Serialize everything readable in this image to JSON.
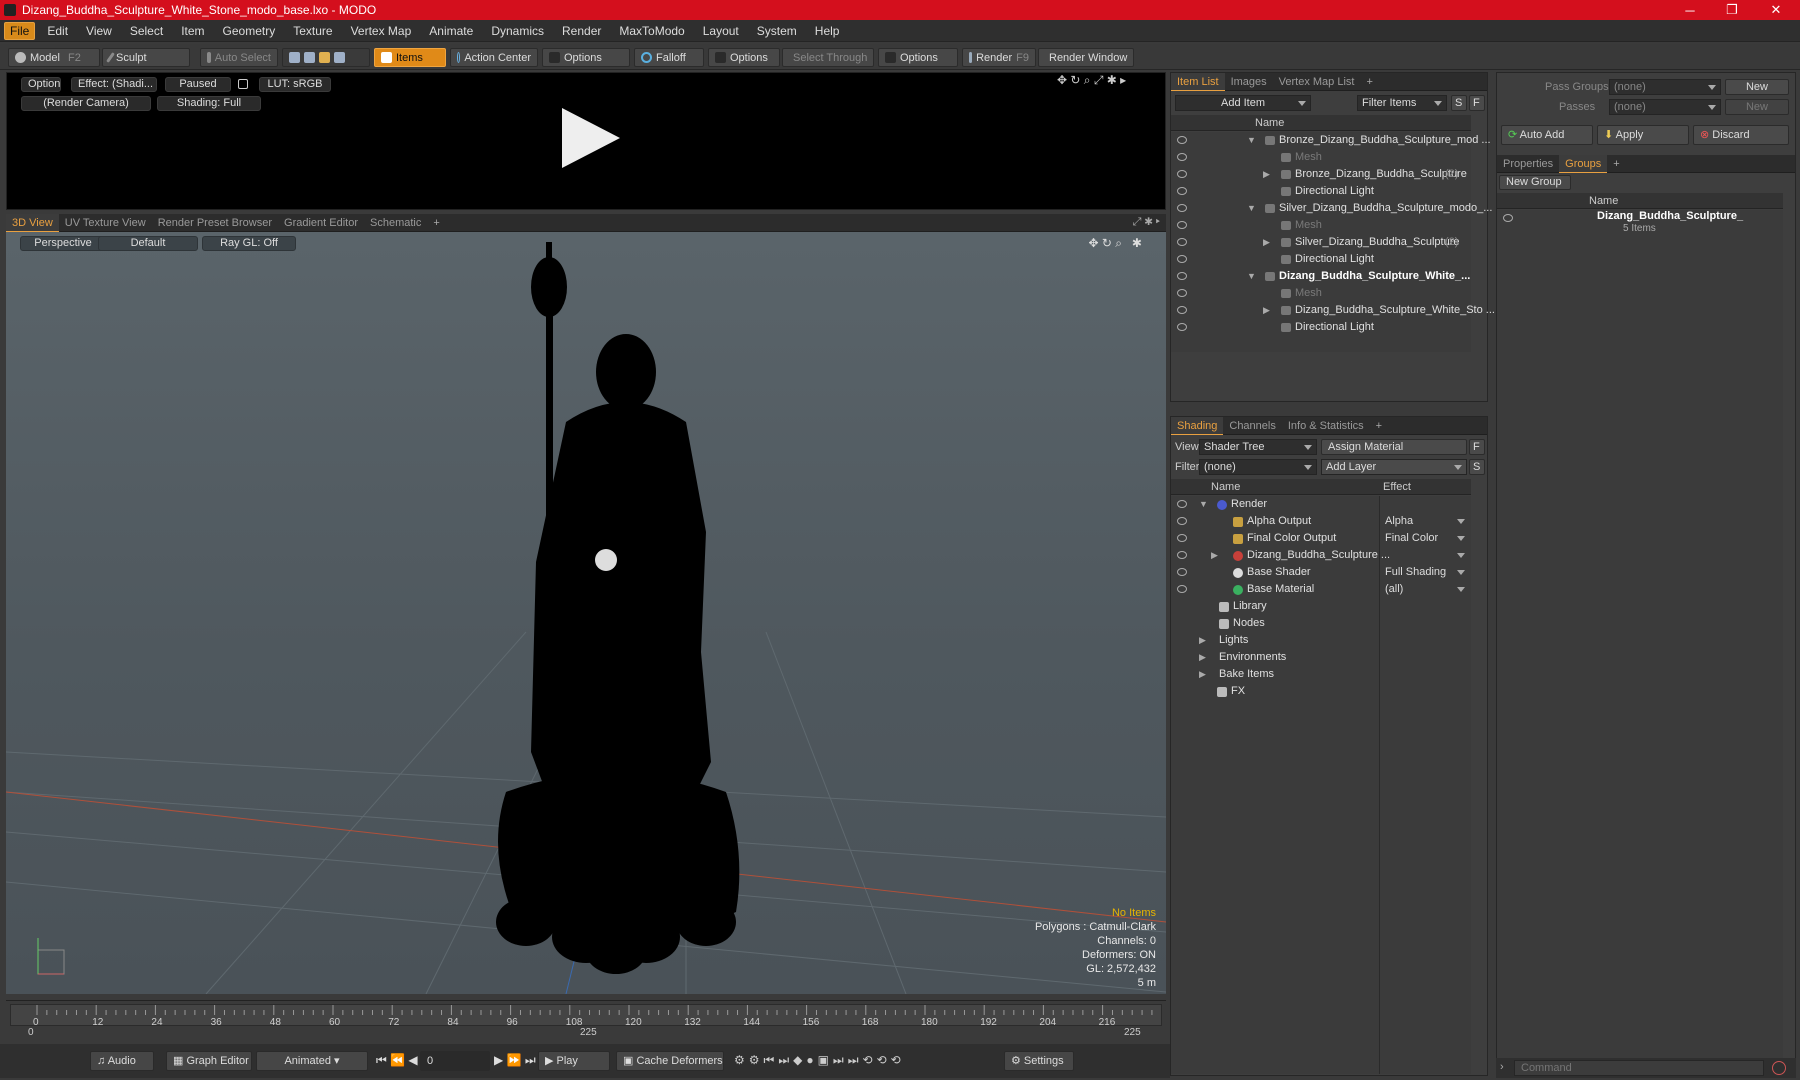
{
  "window": {
    "title": "Dizang_Buddha_Sculpture_White_Stone_modo_base.lxo - MODO",
    "minimize": "─",
    "maximize": "❐",
    "close": "✕"
  },
  "menu": [
    "File",
    "Edit",
    "View",
    "Select",
    "Item",
    "Geometry",
    "Texture",
    "Vertex Map",
    "Animate",
    "Dynamics",
    "Render",
    "MaxToModo",
    "Layout",
    "System",
    "Help"
  ],
  "toolbar": {
    "model": "Model",
    "model_key": "F2",
    "sculpt": "Sculpt",
    "auto_select": "Auto Select",
    "items": "Items",
    "action_center": "Action Center",
    "options1": "Options",
    "falloff": "Falloff",
    "options2": "Options",
    "select_through": "Select Through",
    "options3": "Options",
    "render": "Render",
    "render_key": "F9",
    "render_window": "Render Window"
  },
  "preview": {
    "options": "Options",
    "effect": "Effect: (Shadi...",
    "paused": "Paused",
    "lut": "LUT: sRGB",
    "camera": "(Render Camera)",
    "shading": "Shading: Full"
  },
  "viewport_tabs": [
    "3D View",
    "UV Texture View",
    "Render Preset Browser",
    "Gradient Editor",
    "Schematic",
    "+"
  ],
  "viewport": {
    "perspective": "Perspective",
    "default": "Default",
    "raygl": "Ray GL: Off",
    "info": {
      "no_items": "No Items",
      "polygons": "Polygons : Catmull-Clark",
      "channels": "Channels: 0",
      "deformers": "Deformers: ON",
      "gl": "GL: 2,572,432",
      "dist": "5 m"
    }
  },
  "timeline": {
    "ticks": [
      "0",
      "12",
      "24",
      "36",
      "48",
      "60",
      "72",
      "84",
      "96",
      "108",
      "120",
      "132",
      "144",
      "156",
      "168",
      "180",
      "192",
      "204",
      "216"
    ],
    "start": "0",
    "mid": "225",
    "end": "225"
  },
  "bottom": {
    "audio": "Audio",
    "graph_editor": "Graph Editor",
    "animated": "Animated",
    "frame": "0",
    "play": "Play",
    "cache_deformers": "Cache Deformers",
    "settings": "Settings"
  },
  "item_list": {
    "tabs": [
      "Item List",
      "Images",
      "Vertex Map List",
      "+"
    ],
    "add_item": "Add Item",
    "filter_items": "Filter Items",
    "s": "S",
    "f": "F",
    "col_name": "Name",
    "rows": [
      {
        "label": "Bronze_Dizang_Buddha_Sculpture_mod ...",
        "indent": 0,
        "style": "group"
      },
      {
        "label": "Mesh",
        "indent": 1,
        "style": "dim"
      },
      {
        "label": "Bronze_Dizang_Buddha_Sculpture",
        "count": "(2)",
        "indent": 1,
        "style": "normal"
      },
      {
        "label": "Directional Light",
        "indent": 1,
        "style": "normal"
      },
      {
        "label": "Silver_Dizang_Buddha_Sculpture_modo_...",
        "indent": 0,
        "style": "group"
      },
      {
        "label": "Mesh",
        "indent": 1,
        "style": "dim"
      },
      {
        "label": "Silver_Dizang_Buddha_Sculpture",
        "count": "(2)",
        "indent": 1,
        "style": "normal"
      },
      {
        "label": "Directional Light",
        "indent": 1,
        "style": "normal"
      },
      {
        "label": "Dizang_Buddha_Sculpture_White_...",
        "indent": 0,
        "style": "bold"
      },
      {
        "label": "Mesh",
        "indent": 1,
        "style": "dim"
      },
      {
        "label": "Dizang_Buddha_Sculpture_White_Sto ...",
        "indent": 1,
        "style": "normal"
      },
      {
        "label": "Directional Light",
        "indent": 1,
        "style": "normal"
      }
    ]
  },
  "shading": {
    "tabs": [
      "Shading",
      "Channels",
      "Info & Statistics",
      "+"
    ],
    "view_label": "View",
    "view_value": "Shader Tree",
    "assign_material": "Assign Material",
    "filter_label": "Filter",
    "filter_value": "(none)",
    "add_layer": "Add Layer",
    "f": "F",
    "s": "S",
    "col_name": "Name",
    "col_effect": "Effect",
    "rows": [
      {
        "label": "Render",
        "effect": "",
        "indent": 0
      },
      {
        "label": "Alpha Output",
        "effect": "Alpha",
        "indent": 1
      },
      {
        "label": "Final Color Output",
        "effect": "Final Color",
        "indent": 1
      },
      {
        "label": "Dizang_Buddha_Sculpture ...",
        "effect": "",
        "indent": 1
      },
      {
        "label": "Base Shader",
        "effect": "Full Shading",
        "indent": 1
      },
      {
        "label": "Base Material",
        "effect": "(all)",
        "indent": 1
      },
      {
        "label": "Library",
        "effect": "",
        "indent": 0
      },
      {
        "label": "Nodes",
        "effect": "",
        "indent": 0
      },
      {
        "label": "Lights",
        "effect": "",
        "indent": -1
      },
      {
        "label": "Environments",
        "effect": "",
        "indent": -1
      },
      {
        "label": "Bake Items",
        "effect": "",
        "indent": -1
      },
      {
        "label": "FX",
        "effect": "",
        "indent": 0
      }
    ]
  },
  "groups": {
    "pass_groups_label": "Pass Groups",
    "pass_groups_value": "(none)",
    "new": "New",
    "passes_label": "Passes",
    "passes_value": "(none)",
    "new2": "New",
    "auto_add": "Auto Add",
    "apply": "Apply",
    "discard": "Discard",
    "tabs": [
      "Properties",
      "Groups",
      "+"
    ],
    "new_group": "New Group",
    "col_name": "Name",
    "item_name": "Dizang_Buddha_Sculpture_",
    "item_count": "5 Items"
  },
  "command": {
    "placeholder": "Command"
  }
}
